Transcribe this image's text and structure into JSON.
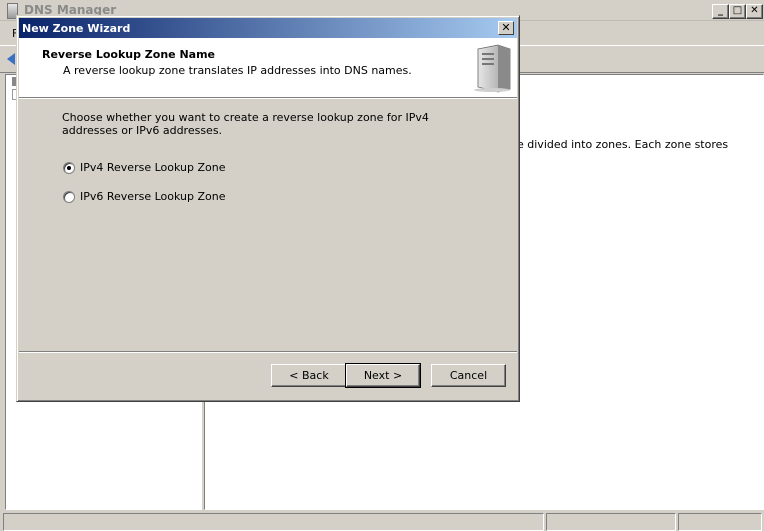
{
  "background_window": {
    "title": "DNS Manager",
    "menu_first": "F",
    "detail_text": "e divided into zones. Each zone stores"
  },
  "dialog": {
    "title": "New Zone Wizard",
    "close_label": "✕",
    "header_title": "Reverse Lookup Zone Name",
    "header_subtitle": "A reverse lookup zone translates IP addresses into DNS names.",
    "instruction": "Choose whether you want to create a reverse lookup zone for IPv4 addresses or IPv6 addresses.",
    "options": [
      {
        "label": "IPv4 Reverse Lookup Zone",
        "selected": true
      },
      {
        "label": "IPv6 Reverse Lookup Zone",
        "selected": false
      }
    ],
    "buttons": {
      "back": "< Back",
      "next": "Next >",
      "cancel": "Cancel"
    }
  },
  "window_controls": {
    "minimize": "_",
    "maximize": "□",
    "close": "✕"
  }
}
